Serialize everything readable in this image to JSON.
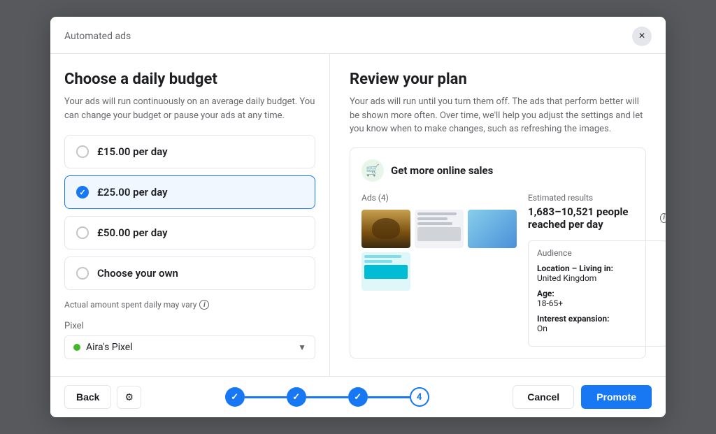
{
  "modal": {
    "header_title": "Automated ads",
    "close_label": "×"
  },
  "left": {
    "title": "Choose a daily budget",
    "description": "Your ads will run continuously on an average daily budget. You can change your budget or pause your ads at any time.",
    "options": [
      {
        "id": "opt1",
        "label": "£15.00 per day",
        "selected": false
      },
      {
        "id": "opt2",
        "label": "£25.00 per day",
        "selected": true
      },
      {
        "id": "opt3",
        "label": "£50.00 per day",
        "selected": false
      },
      {
        "id": "opt4",
        "label": "Choose your own",
        "selected": false
      }
    ],
    "actual_note": "Actual amount spent daily may vary",
    "pixel_label": "Pixel",
    "pixel_name": "Aira's Pixel"
  },
  "right": {
    "title": "Review your plan",
    "description": "Your ads will run until you turn them off. The ads that perform better will be shown more often. Over time, we'll help you adjust the settings and let you know when to make changes, such as refreshing the images.",
    "plan_title": "Get more online sales",
    "ads_label": "Ads (4)",
    "results_label": "Estimated results",
    "results_value": "1,683–10,521 people reached per day",
    "audience_label": "Audience",
    "location_label": "Location – Living in:",
    "location_value": "United Kingdom",
    "age_label": "Age:",
    "age_value": "18-65+",
    "interest_label": "Interest expansion:",
    "interest_value": "On"
  },
  "footer": {
    "back_label": "Back",
    "cancel_label": "Cancel",
    "promote_label": "Promote",
    "step4_label": "4"
  }
}
